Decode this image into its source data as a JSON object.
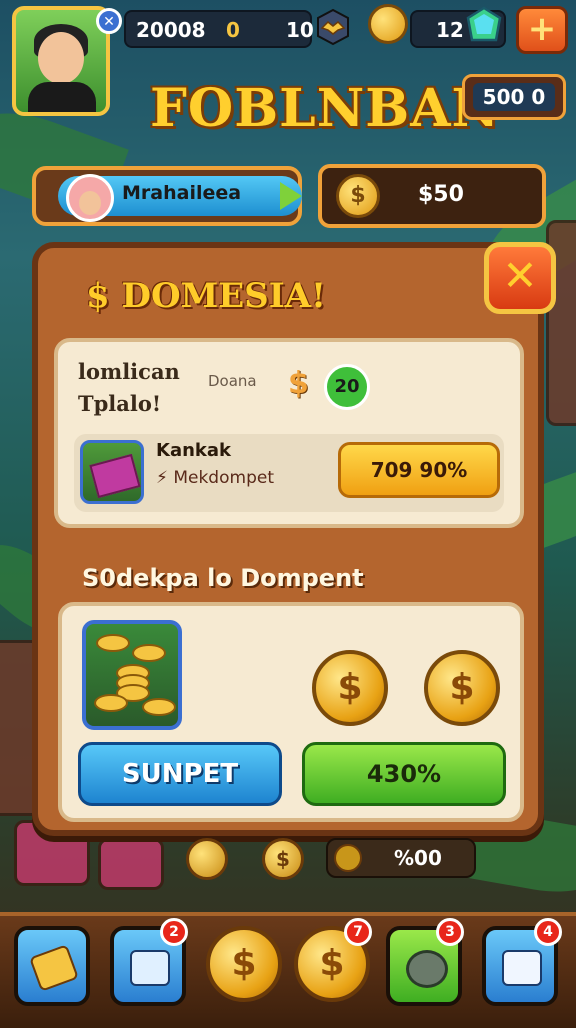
{
  "hud": {
    "stat_a": "20008",
    "stat_b": "0",
    "stat_c": "10",
    "gem_count": "12",
    "plus_label": "+",
    "score": "500 0"
  },
  "title": "FOBLNBAN",
  "player": {
    "name": "Mrahaileea"
  },
  "cash": {
    "coin_symbol": "$",
    "value": "$50"
  },
  "panel": {
    "title": "$ DOMESIA!",
    "close_label": "✕",
    "card1": {
      "label_line1": "lomlican",
      "label_line2": "Tplalo!",
      "sub": "Doana",
      "dollar": "$",
      "badge": "20",
      "offer": {
        "title": "Kankak",
        "sub": "⚡ Mekdompet",
        "button": "709 90%"
      }
    },
    "section_title": "S0dekpa lo Dompent",
    "card2": {
      "coin_symbol": "$",
      "blue_button": "SUNPET",
      "green_button": "430%"
    }
  },
  "under": {
    "coin_symbol": "$",
    "value": "%00"
  },
  "bottom_nav": {
    "coin_symbol": "$",
    "badges": [
      "2",
      "7",
      "3",
      "4"
    ]
  },
  "colors": {
    "accent_gold": "#f5c542",
    "panel_wood": "#b4652e",
    "button_green": "#3fae22",
    "button_blue": "#1e84d0"
  }
}
